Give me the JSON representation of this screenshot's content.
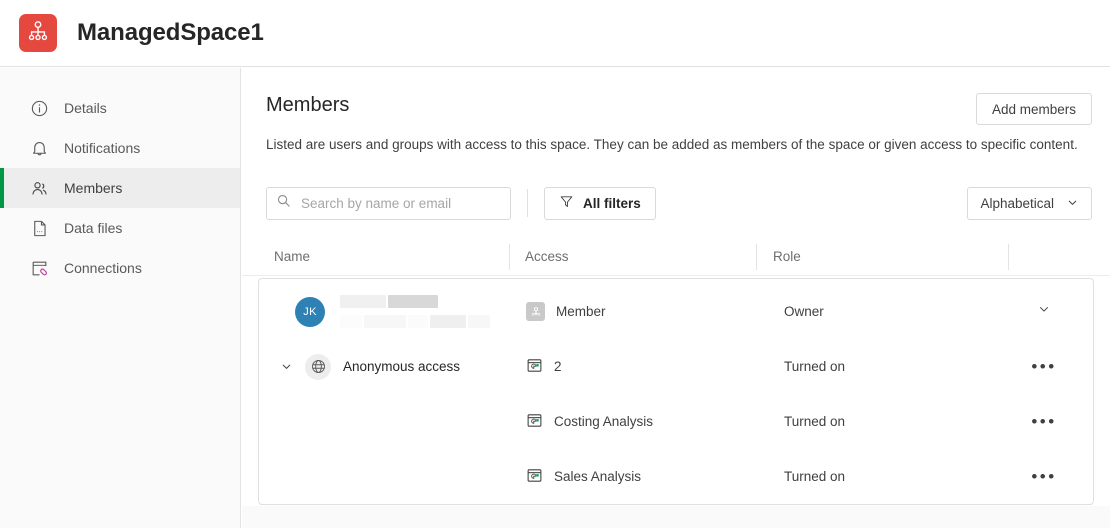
{
  "topbar": {
    "logo_icon": "hierarchy-icon",
    "logo_color": "#e4483f",
    "title": "ManagedSpace1"
  },
  "sidebar": {
    "items": [
      {
        "label": "Details",
        "icon": "info-circle-icon",
        "active": false
      },
      {
        "label": "Notifications",
        "icon": "bell-icon",
        "active": false
      },
      {
        "label": "Members",
        "icon": "people-icon",
        "active": true
      },
      {
        "label": "Data files",
        "icon": "file-icon",
        "active": false
      },
      {
        "label": "Connections",
        "icon": "connections-icon",
        "active": false
      }
    ],
    "active_accent": "#009845"
  },
  "main": {
    "title": "Members",
    "description": "Listed are users and groups with access to this space. They can be added as members of the space or given access to specific content.",
    "add_members_label": "Add members"
  },
  "toolbar": {
    "search_placeholder": "Search by name or email",
    "search_value": "",
    "search_icon": "search-icon",
    "filters_label": "All filters",
    "filters_icon": "funnel-icon",
    "sort_label": "Alphabetical",
    "sort_icon": "chevron-down-icon"
  },
  "table": {
    "columns": [
      "Name",
      "Access",
      "Role",
      ""
    ],
    "rows": [
      {
        "type": "user",
        "avatar_initials": "JK",
        "avatar_color": "#2e81b5",
        "name_redacted": true,
        "access_icon": "member-badge-icon",
        "access": "Member",
        "role": "Owner",
        "action_icon": "chevron-down-icon"
      },
      {
        "type": "group",
        "expander_icon": "chevron-down-icon",
        "group_icon": "globe-icon",
        "name": "Anonymous access",
        "access_icon": "app-icon",
        "access": "2",
        "role": "Turned on",
        "action_icon": "kebab-menu-icon",
        "action_label": "•••"
      },
      {
        "type": "child",
        "access_icon": "app-icon",
        "access": "Costing Analysis",
        "role": "Turned on",
        "action_icon": "kebab-menu-icon",
        "action_label": "•••"
      },
      {
        "type": "child",
        "access_icon": "app-icon",
        "access": "Sales Analysis",
        "role": "Turned on",
        "action_icon": "kebab-menu-icon",
        "action_label": "•••"
      }
    ]
  }
}
